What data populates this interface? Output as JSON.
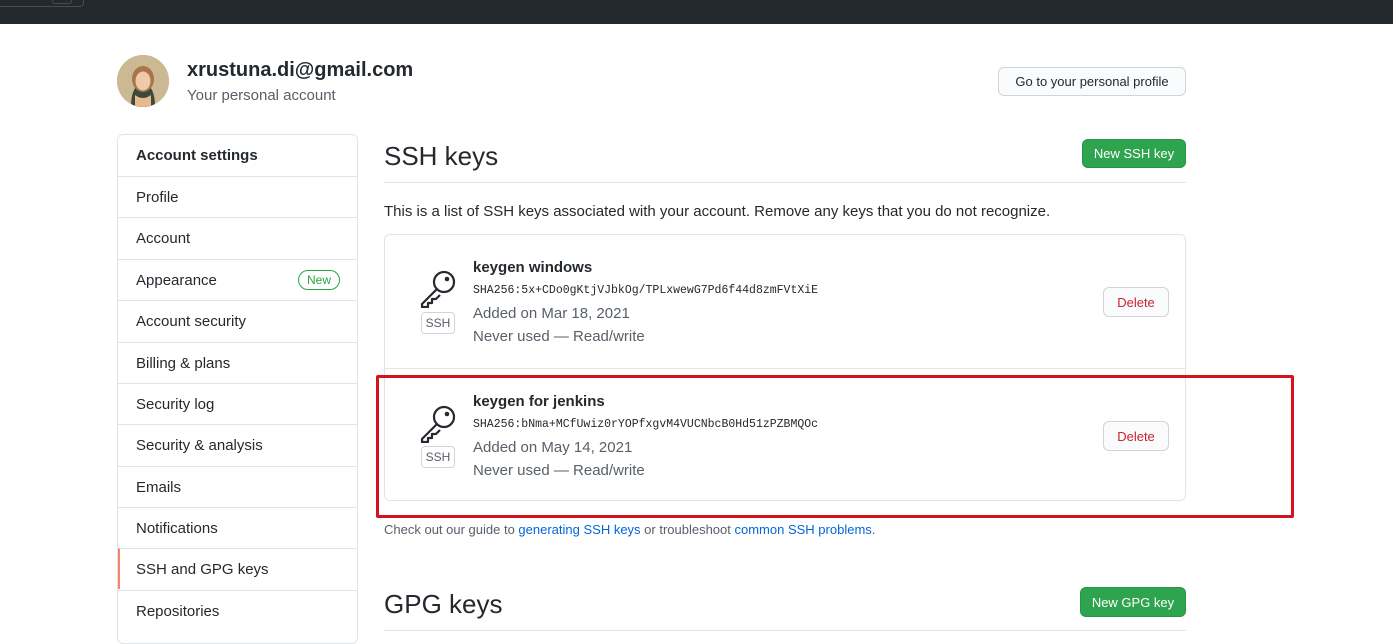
{
  "account": {
    "email": "xrustuna.di@gmail.com",
    "subtitle": "Your personal account",
    "profile_button": "Go to your personal profile"
  },
  "menu": {
    "heading": "Account settings",
    "items": [
      {
        "label": "Profile"
      },
      {
        "label": "Account"
      },
      {
        "label": "Appearance",
        "badge": "New"
      },
      {
        "label": "Account security"
      },
      {
        "label": "Billing & plans"
      },
      {
        "label": "Security log"
      },
      {
        "label": "Security & analysis"
      },
      {
        "label": "Emails"
      },
      {
        "label": "Notifications"
      },
      {
        "label": "SSH and GPG keys",
        "selected": true
      },
      {
        "label": "Repositories"
      }
    ]
  },
  "ssh": {
    "title": "SSH keys",
    "new_button": "New SSH key",
    "description": "This is a list of SSH keys associated with your account. Remove any keys that you do not recognize.",
    "keys": [
      {
        "title": "keygen windows",
        "fingerprint": "SHA256:5x+CDo0gKtjVJbkOg/TPLxwewG7Pd6f44d8zmFVtXiE",
        "added": "Added on Mar 18, 2021",
        "usage": "Never used — Read/write",
        "type_label": "SSH",
        "delete_label": "Delete"
      },
      {
        "title": "keygen for jenkins",
        "fingerprint": "SHA256:bNma+MCfUwiz0rYOPfxgvM4VUCNbcB0Hd51zPZBMQOc",
        "added": "Added on May 14, 2021",
        "usage": "Never used — Read/write",
        "type_label": "SSH",
        "delete_label": "Delete"
      }
    ],
    "guide": {
      "prefix": "Check out our guide to ",
      "link1": "generating SSH keys",
      "middle": " or troubleshoot ",
      "link2": "common SSH problems",
      "suffix": "."
    }
  },
  "gpg": {
    "title": "GPG keys",
    "new_button": "New GPG key"
  },
  "colors": {
    "primary_green": "#2ea44f",
    "danger_red": "#cb2431",
    "link_blue": "#0366d6",
    "selected_accent": "#f9826c",
    "highlight_box": "#d4141c",
    "topbar": "#24292e"
  }
}
